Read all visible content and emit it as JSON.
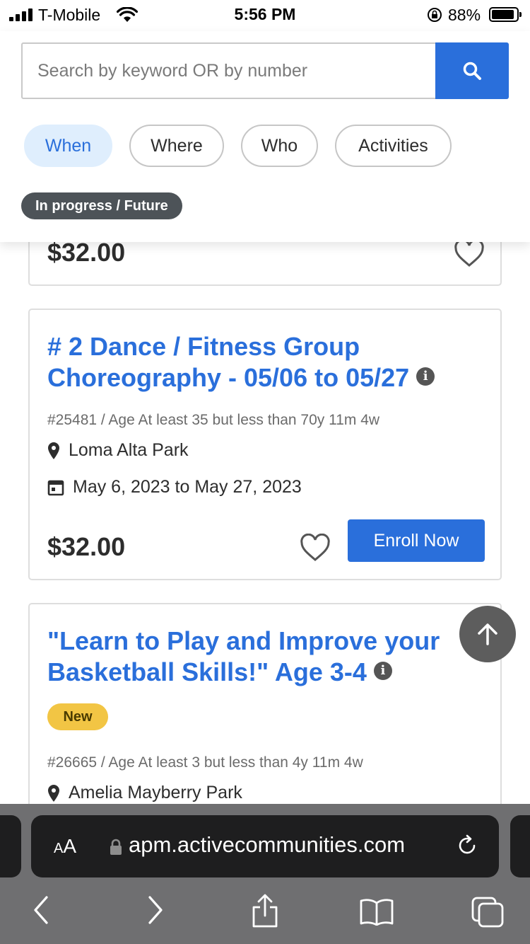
{
  "status_bar": {
    "carrier": "T-Mobile",
    "time": "5:56 PM",
    "battery": "88%"
  },
  "search": {
    "placeholder": "Search by keyword OR by number"
  },
  "filters": [
    "When",
    "Where",
    "Who",
    "Activities"
  ],
  "active_filter": "When",
  "filter_tag": "In progress / Future",
  "colors": {
    "accent": "#2a6fdb",
    "chip_active_bg": "#dfeefd",
    "new_badge": "#f2c544",
    "tag_dark": "#4d5358"
  },
  "cards": [
    {
      "price": "$32.00"
    },
    {
      "title": "# 2 Dance / Fitness Group Choreography - 05/06 to 05/27",
      "meta": "#25481 / Age At least 35 but less than 70y 11m 4w",
      "location": "Loma Alta Park",
      "dates": "May 6, 2023 to May 27, 2023",
      "price": "$32.00",
      "enroll_label": "Enroll Now"
    },
    {
      "title": "\"Learn to Play and Improve your Basketball Skills!\" Age 3-4",
      "badge": "New",
      "meta": "#26665 / Age At least 3 but less than 4y 11m 4w",
      "location": "Amelia Mayberry Park"
    }
  ],
  "browser": {
    "aa_small": "A",
    "aa_large": "A",
    "url": "apm.activecommunities.com"
  },
  "icons": [
    "search-icon",
    "heart-icon",
    "info-icon",
    "map-pin-icon",
    "calendar-icon",
    "arrow-up-icon",
    "lock-icon",
    "reload-icon",
    "back-icon",
    "forward-icon",
    "share-icon",
    "bookmarks-icon",
    "tabs-icon"
  ]
}
